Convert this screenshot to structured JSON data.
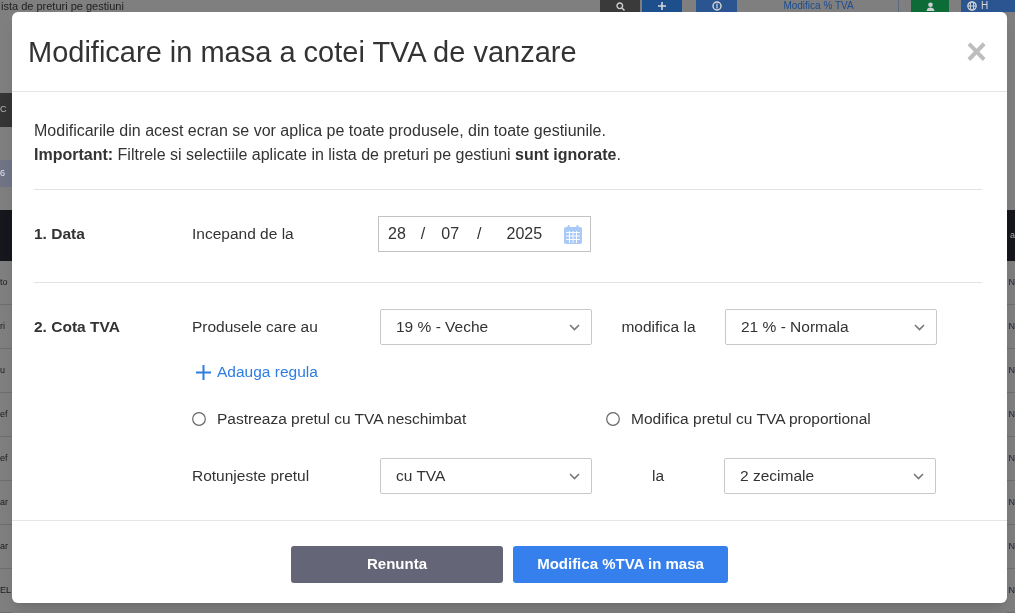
{
  "background": {
    "page_title": "ista de preturi pe gestiuni",
    "toolbar": [
      {
        "kind": "search"
      },
      {
        "kind": "add"
      },
      {
        "kind": "coin"
      },
      {
        "kind": "link",
        "label": "Modifica % TVA"
      },
      {
        "kind": "user"
      },
      {
        "kind": "globe",
        "label": "H"
      }
    ],
    "left_panel": {
      "bar": "C",
      "filter": "6"
    },
    "table": {
      "header_right": "a",
      "rows": [
        {
          "first_cell": "to",
          "last_cell": "N"
        },
        {
          "first_cell": "ri",
          "last_cell": "N"
        },
        {
          "first_cell": "u",
          "last_cell": "N"
        },
        {
          "first_cell": "ef",
          "last_cell": "N"
        },
        {
          "first_cell": "ef",
          "last_cell": "N"
        },
        {
          "first_cell": "ar",
          "last_cell": "N"
        },
        {
          "first_cell": "ar",
          "last_cell": "N"
        },
        {
          "first_cell": "EL",
          "last_cell": "N"
        }
      ]
    }
  },
  "dialog": {
    "title": "Modificare in masa a cotei TVA de vanzare",
    "close": "×",
    "intro": [
      "Modificarile din acest ecran se vor aplica pe toate produsele, din toate gestiunile.",
      "**Important:** Filtrele si selectiile aplicate in lista de preturi pe gestiuni **sunt ignorate**."
    ],
    "sections": [
      {
        "kind": "date",
        "heading": "1. Data",
        "label": "Incepand de la",
        "date": {
          "day": "28",
          "month": "07",
          "year": "2025",
          "separators": [
            "/",
            "/"
          ]
        }
      },
      {
        "kind": "vat",
        "heading": "2. Cota TVA",
        "rules": [
          {
            "label": "Produsele care au",
            "from": "19 % - Veche",
            "connector": "modifica la",
            "to": "21 % - Normala"
          }
        ],
        "add_rule": "Adauga regula",
        "price_options": [
          {
            "label": "Pastreaza pretul cu TVA neschimbat",
            "selected": false
          },
          {
            "label": "Modifica pretul cu TVA proportional",
            "selected": false
          }
        ],
        "rounding": {
          "label": "Rotunjeste pretul",
          "mode": "cu TVA",
          "connector": "la",
          "precision": "2 zecimale"
        }
      }
    ],
    "buttons": [
      {
        "kind": "secondary",
        "label": "Renunta"
      },
      {
        "kind": "primary",
        "label": "Modifica %TVA in masa"
      }
    ]
  }
}
